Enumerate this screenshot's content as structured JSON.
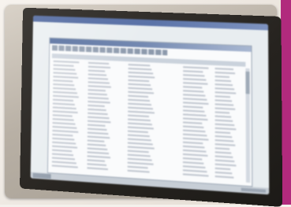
{
  "scene": {
    "accent_color": "#b12a7d",
    "screen_color": "#f3f6f8",
    "titlebar_color": "#2f4f9a"
  },
  "table": {
    "row_count": 28
  }
}
